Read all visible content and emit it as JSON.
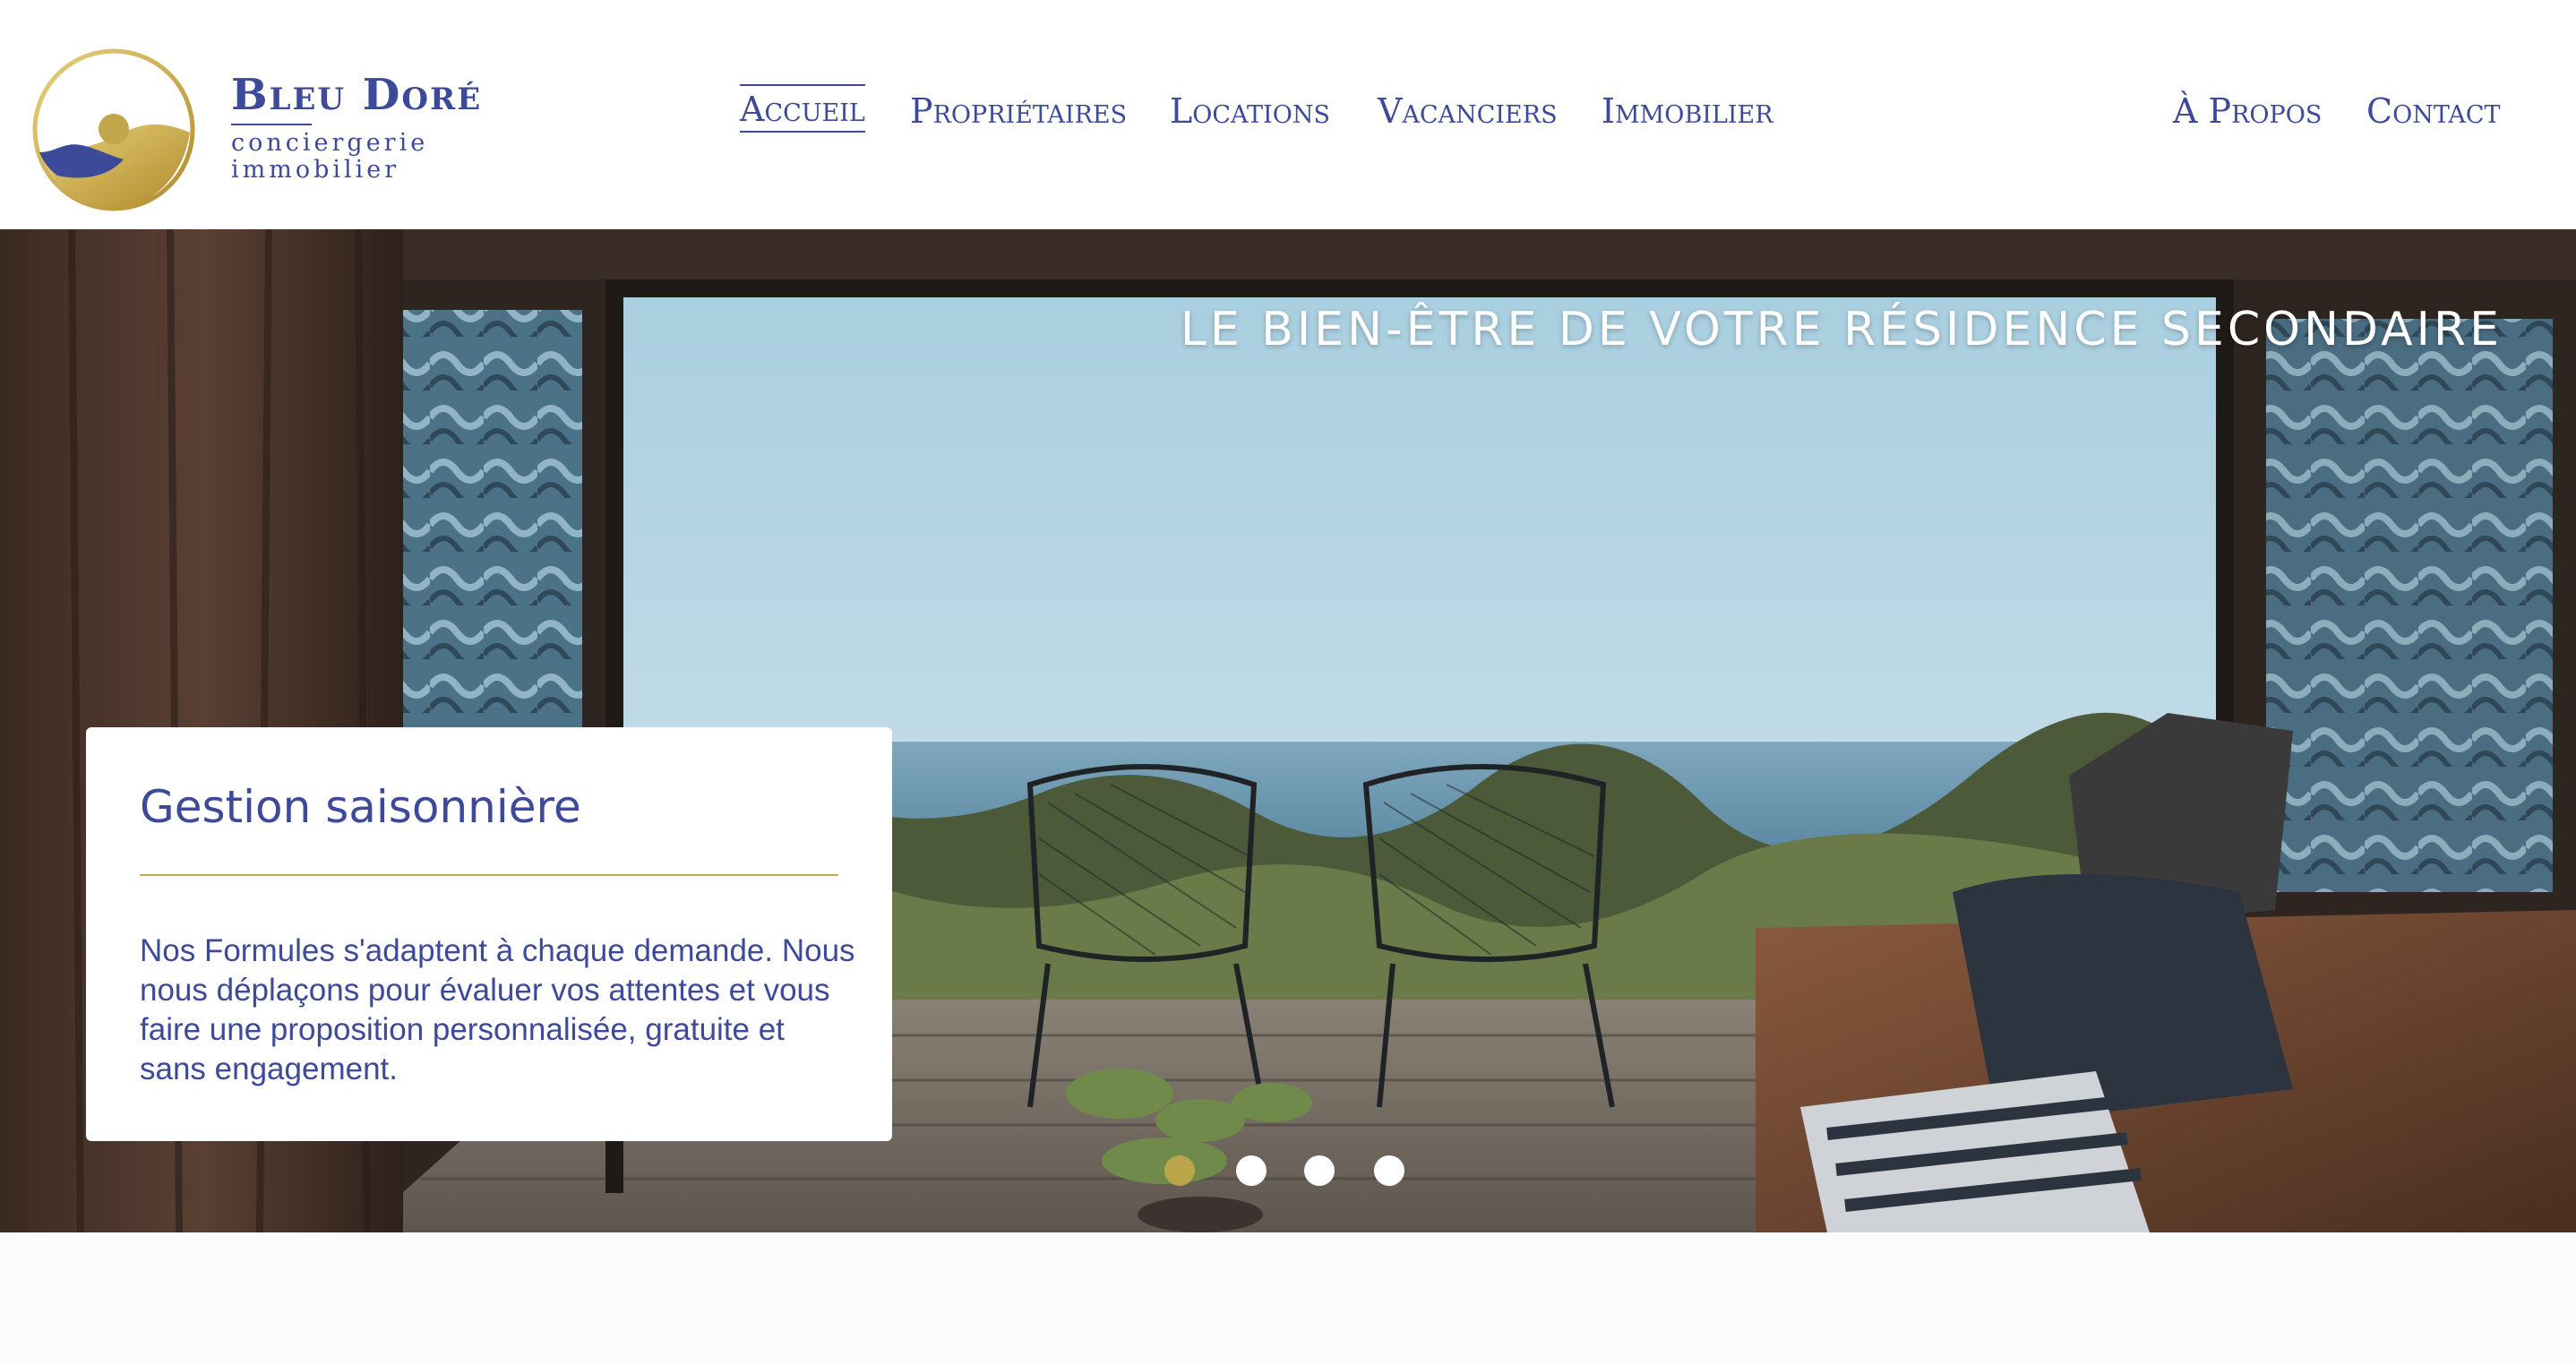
{
  "brand": {
    "name": "Bleu Doré",
    "line1": "conciergerie",
    "line2": "immobilier"
  },
  "nav": {
    "items": [
      {
        "label": "Accueil",
        "active": true
      },
      {
        "label": "Propriétaires",
        "active": false
      },
      {
        "label": "Locations",
        "active": false
      },
      {
        "label": "Vacanciers",
        "active": false
      },
      {
        "label": "Immobilier",
        "active": false
      }
    ],
    "right": [
      {
        "label": "À Propos"
      },
      {
        "label": "Contact"
      }
    ]
  },
  "hero": {
    "tagline": "LE BIEN-ÊTRE DE VOTRE RÉSIDENCE SECONDAIRE",
    "card": {
      "title": "Gestion saisonnière",
      "text": "Nos Formules s'adaptent à chaque demande. Nous nous déplaçons pour évaluer vos attentes et vous faire une proposition personnalisée, gratuite et sans engagement."
    },
    "slides_total": 4,
    "active_slide": 1
  },
  "colors": {
    "brand_blue": "#3d4a99",
    "brand_gold": "#c2a74a"
  }
}
